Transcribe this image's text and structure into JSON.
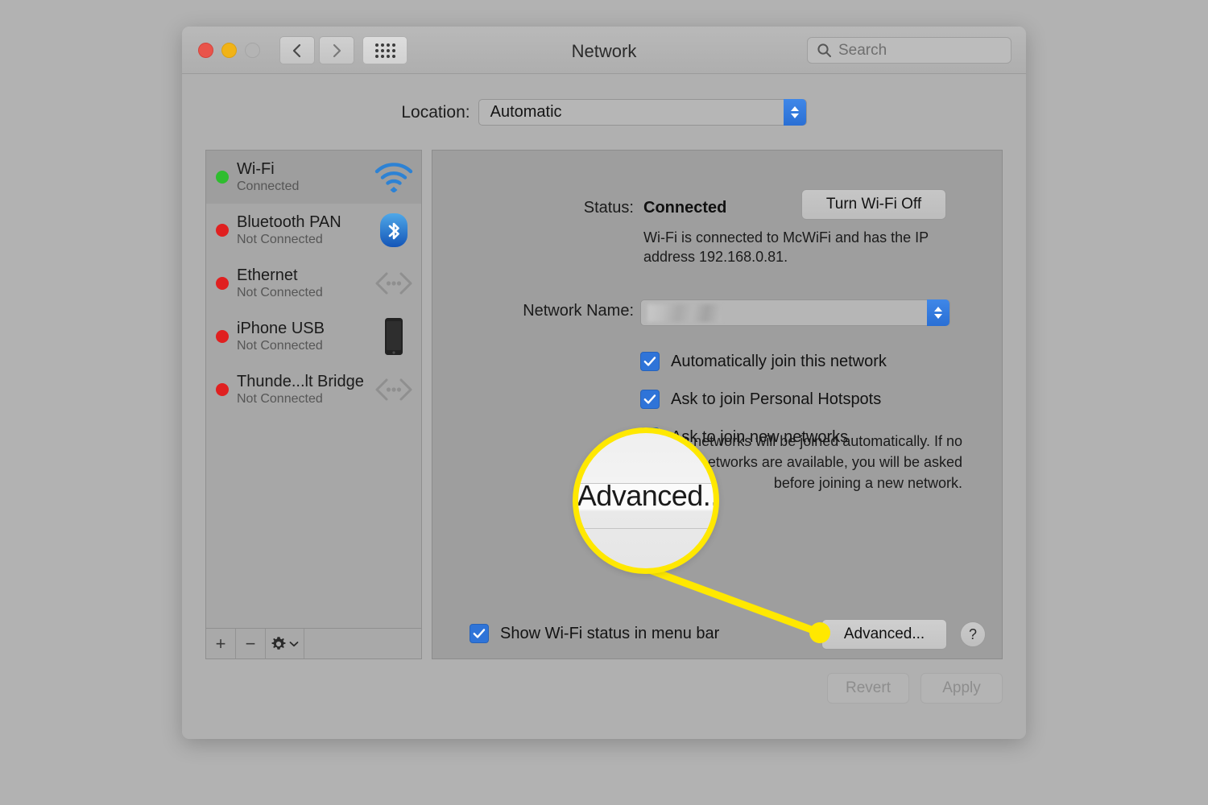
{
  "window": {
    "title": "Network",
    "traffic_lights": [
      "close",
      "minimize",
      "zoom"
    ],
    "nav": {
      "back": "back-icon",
      "forward": "forward-icon",
      "grid": "show-all-icon"
    },
    "search": {
      "placeholder": "Search",
      "value": ""
    }
  },
  "location": {
    "label": "Location:",
    "selected": "Automatic"
  },
  "sidebar": {
    "services": [
      {
        "name": "Wi-Fi",
        "state": "Connected",
        "dot": "green",
        "icon": "wifi-icon",
        "selected": true
      },
      {
        "name": "Bluetooth PAN",
        "state": "Not Connected",
        "dot": "red",
        "icon": "bluetooth-icon",
        "selected": false
      },
      {
        "name": "Ethernet",
        "state": "Not Connected",
        "dot": "red",
        "icon": "ethernet-icon",
        "selected": false
      },
      {
        "name": "iPhone USB",
        "state": "Not Connected",
        "dot": "red",
        "icon": "iphone-icon",
        "selected": false
      },
      {
        "name": "Thunde...lt Bridge",
        "state": "Not Connected",
        "dot": "red",
        "icon": "ethernet-icon",
        "selected": false
      }
    ],
    "footer": {
      "add": "+",
      "remove": "−",
      "actions": "gear-icon"
    }
  },
  "detail": {
    "status_label": "Status:",
    "status_value": "Connected",
    "toggle_button": "Turn Wi-Fi Off",
    "status_description": "Wi-Fi is connected to McWiFi and has the IP address 192.168.0.81.",
    "network_name_label": "Network Name:",
    "network_name_value": "",
    "checkboxes": [
      {
        "label": "Automatically join this network",
        "checked": true
      },
      {
        "label": "Ask to join Personal Hotspots",
        "checked": true
      },
      {
        "label": "Ask to join new networks",
        "checked": true
      }
    ],
    "help_text": "Known networks will be joined automatically. If no known networks are available, you will be asked before joining a new network.",
    "menu_bar_checkbox": {
      "label": "Show Wi-Fi status in menu bar",
      "checked": true
    },
    "advanced_button": "Advanced...",
    "help_button": "?"
  },
  "footer": {
    "revert": "Revert",
    "apply": "Apply"
  },
  "callout": {
    "magnified_label": "Advanced...",
    "color": "#ffe800"
  },
  "colors": {
    "page_background": "#b2b2b2",
    "window_background": "#b0b0b0",
    "panel_background": "#9e9e9e",
    "accent_blue": "#2f74d8",
    "status_connected": "#2fbd2f",
    "status_disconnected": "#e02020",
    "callout_yellow": "#ffe800"
  }
}
